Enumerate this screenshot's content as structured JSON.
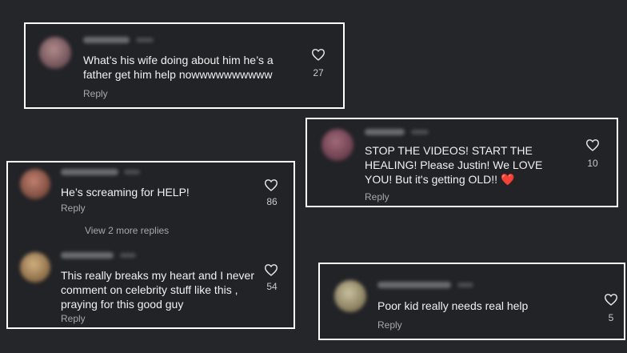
{
  "comments": [
    {
      "text": "What’s his wife doing about him he’s a\nfather get him help nowwwwwwwwww",
      "reply_label": "Reply",
      "likes": "27",
      "avatar_color": "#8d6e6e"
    },
    {
      "text": "STOP THE VIDEOS! START THE\nHEALING! Please Justin! We LOVE\nYOU! But it's getting OLD!! ",
      "emoji": "❤️",
      "reply_label": "Reply",
      "likes": "10",
      "avatar_color": "#7a4a5a"
    },
    {
      "text": "He’s screaming for HELP!",
      "reply_label": "Reply",
      "likes": "86",
      "avatar_color": "#9a7060"
    },
    {
      "text": "This really breaks my heart and I never\ncomment on celebrity stuff like this ,\npraying for this good guy",
      "reply_label": "Reply",
      "likes": "54",
      "avatar_color": "#a08a6a"
    },
    {
      "text": "Poor kid really needs real help",
      "reply_label": "Reply",
      "likes": "5",
      "avatar_color": "#8a8a6e"
    }
  ],
  "view_more_replies": "View 2 more replies",
  "colors": {
    "background": "#25262a",
    "card_border": "#ffffff",
    "text": "#f1f1f1",
    "muted": "#a7a8ac"
  },
  "icons": {
    "like": "heart-outline-icon",
    "emoji": "red-heart-emoji"
  }
}
